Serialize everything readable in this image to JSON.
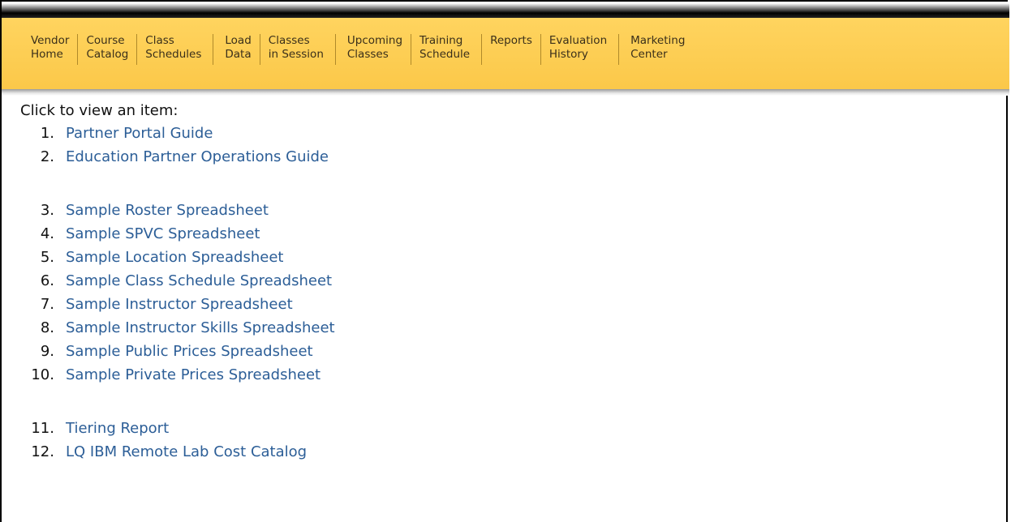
{
  "nav": {
    "items": [
      {
        "line1": "Vendor",
        "line2": "Home"
      },
      {
        "line1": "Course",
        "line2": "Catalog"
      },
      {
        "line1": "Class",
        "line2": "Schedules"
      },
      {
        "line1": "Load",
        "line2": "Data"
      },
      {
        "line1": "Classes",
        "line2": "in Session"
      },
      {
        "line1": "Upcoming",
        "line2": "Classes"
      },
      {
        "line1": "Training",
        "line2": "Schedule"
      },
      {
        "line1": "Reports",
        "line2": ""
      },
      {
        "line1": "Evaluation",
        "line2": "History"
      },
      {
        "line1": "Marketing",
        "line2": "Center"
      }
    ]
  },
  "content": {
    "intro": "Click to view an item:",
    "items": [
      {
        "num": "1.",
        "label": "Partner Portal Guide"
      },
      {
        "num": "2.",
        "label": "Education Partner Operations Guide"
      },
      {
        "num": "3.",
        "label": "Sample Roster Spreadsheet"
      },
      {
        "num": "4.",
        "label": "Sample SPVC Spreadsheet"
      },
      {
        "num": "5.",
        "label": "Sample Location Spreadsheet"
      },
      {
        "num": "6.",
        "label": "Sample Class Schedule Spreadsheet"
      },
      {
        "num": "7.",
        "label": "Sample Instructor Spreadsheet"
      },
      {
        "num": "8.",
        "label": "Sample Instructor Skills Spreadsheet"
      },
      {
        "num": "9.",
        "label": "Sample Public Prices Spreadsheet"
      },
      {
        "num": "10.",
        "label": "Sample Private Prices Spreadsheet"
      },
      {
        "num": "11.",
        "label": "Tiering Report"
      },
      {
        "num": "12.",
        "label": "LQ IBM Remote Lab Cost Catalog"
      }
    ]
  },
  "colors": {
    "nav_background": "#fbc849",
    "link": "#2c5e97"
  }
}
